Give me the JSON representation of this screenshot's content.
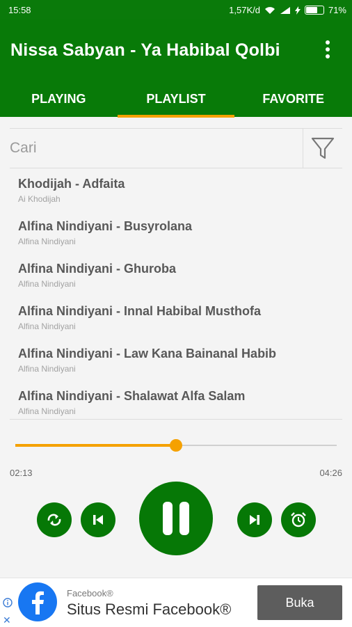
{
  "status_bar": {
    "time": "15:58",
    "network_speed": "1,57K/d",
    "battery": "71%",
    "battery_level": 0.71
  },
  "app_bar": {
    "title": "Nissa Sabyan - Ya Habibal Qolbi",
    "menu_icon": "more-vert-icon"
  },
  "tabs": [
    {
      "label": "PLAYING",
      "active": false
    },
    {
      "label": "PLAYLIST",
      "active": true
    },
    {
      "label": "FAVORITE",
      "active": false
    }
  ],
  "search": {
    "placeholder": "Cari",
    "value": "",
    "filter_icon": "filter-icon"
  },
  "playlist": [
    {
      "title": "Khodijah - Adfaita",
      "artist": "Ai Khodijah"
    },
    {
      "title": "Alfina Nindiyani - Busyrolana",
      "artist": "Alfina Nindiyani"
    },
    {
      "title": "Alfina Nindiyani - Ghuroba",
      "artist": "Alfina Nindiyani"
    },
    {
      "title": "Alfina Nindiyani - Innal Habibal Musthofa",
      "artist": "Alfina Nindiyani"
    },
    {
      "title": "Alfina Nindiyani - Law Kana Bainanal Habib",
      "artist": "Alfina Nindiyani"
    },
    {
      "title": "Alfina Nindiyani - Shalawat Alfa Salam",
      "artist": "Alfina Nindiyani"
    }
  ],
  "player": {
    "current_time": "02:13",
    "total_time": "04:26",
    "progress": 0.5,
    "controls": [
      "repeat-icon",
      "previous-icon",
      "pause-icon",
      "next-icon",
      "alarm-icon"
    ]
  },
  "ad": {
    "source": "Facebook®",
    "title": "Situs Resmi Facebook®",
    "button_label": "Buka",
    "logo_letter": "f"
  },
  "colors": {
    "primary": "#087a08",
    "accent": "#f5a100",
    "ad_button": "#5d5d5d"
  }
}
